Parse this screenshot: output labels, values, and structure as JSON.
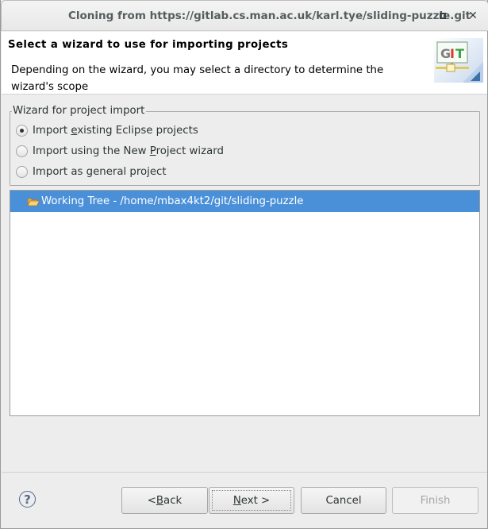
{
  "window": {
    "title": "Cloning from https://gitlab.cs.man.ac.uk/karl.tye/sliding-puzzle.git",
    "maximize_icon": "maximize-icon",
    "close_icon": "close-icon",
    "close_glyph": "✕"
  },
  "header": {
    "title": "Select a wizard to use for importing projects",
    "description": "Depending on the wizard, you may select a directory to determine the wizard's scope",
    "logo_text": "GIT"
  },
  "wizard_group": {
    "legend": "Wizard for project import",
    "options": [
      {
        "pre": "Import ",
        "mnemonic": "e",
        "post": "xisting Eclipse projects",
        "selected": true
      },
      {
        "pre": "Import using the New ",
        "mnemonic": "P",
        "post": "roject wizard",
        "selected": false
      },
      {
        "pre": "Import as general project",
        "mnemonic": "",
        "post": "",
        "selected": false
      }
    ]
  },
  "tree": {
    "items": [
      {
        "label": "Working Tree - /home/mbax4kt2/git/sliding-puzzle",
        "icon": "folder-open-icon",
        "selected": true
      }
    ]
  },
  "footer": {
    "help_glyph": "?",
    "back": {
      "pre": "< ",
      "mnemonic": "B",
      "post": "ack"
    },
    "next": {
      "pre": "",
      "mnemonic": "N",
      "post": "ext >"
    },
    "cancel": "Cancel",
    "finish": "Finish",
    "finish_enabled": false
  },
  "colors": {
    "selection": "#4a90d9",
    "background": "#ededed"
  }
}
